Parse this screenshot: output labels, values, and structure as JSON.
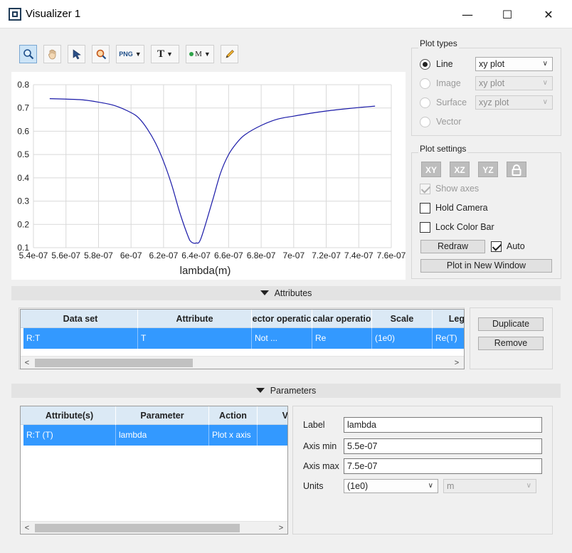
{
  "window": {
    "title": "Visualizer 1",
    "minimize": "—",
    "maximize": "☐",
    "close": "✕"
  },
  "toolbar": {
    "png_label": "PNG",
    "text_label": "T",
    "marker_label": "M"
  },
  "chart_data": {
    "type": "line",
    "xlabel": "lambda(m)",
    "ylabel": "",
    "xlim": [
      5.4e-07,
      7.6e-07
    ],
    "ylim": [
      0.1,
      0.8
    ],
    "x_ticks": [
      "5.4e-07",
      "5.6e-07",
      "5.8e-07",
      "6e-07",
      "6.2e-07",
      "6.4e-07",
      "6.6e-07",
      "6.8e-07",
      "7e-07",
      "7.2e-07",
      "7.4e-07",
      "7.6e-07"
    ],
    "y_ticks": [
      "0.1",
      "0.2",
      "0.3",
      "0.4",
      "0.5",
      "0.6",
      "0.7",
      "0.8"
    ],
    "grid": true,
    "series": [
      {
        "color": "#1a1aa8",
        "x": [
          5.5e-07,
          5.6e-07,
          5.7e-07,
          5.8e-07,
          5.9e-07,
          6e-07,
          6.05e-07,
          6.1e-07,
          6.15e-07,
          6.2e-07,
          6.25e-07,
          6.3e-07,
          6.35e-07,
          6.37e-07,
          6.4e-07,
          6.43e-07,
          6.5e-07,
          6.55e-07,
          6.6e-07,
          6.65e-07,
          6.7e-07,
          6.8e-07,
          6.9e-07,
          7e-07,
          7.1e-07,
          7.2e-07,
          7.3e-07,
          7.4e-07,
          7.5e-07
        ],
        "y": [
          0.74,
          0.738,
          0.735,
          0.725,
          0.71,
          0.68,
          0.655,
          0.61,
          0.55,
          0.47,
          0.37,
          0.25,
          0.15,
          0.125,
          0.12,
          0.14,
          0.3,
          0.42,
          0.5,
          0.55,
          0.585,
          0.625,
          0.652,
          0.665,
          0.677,
          0.687,
          0.695,
          0.702,
          0.708
        ]
      }
    ]
  },
  "plot_types": {
    "title": "Plot types",
    "line": {
      "label": "Line",
      "select": "xy plot"
    },
    "image": {
      "label": "Image",
      "select": "xy plot"
    },
    "surface": {
      "label": "Surface",
      "select": "xyz plot"
    },
    "vector": {
      "label": "Vector"
    }
  },
  "plot_settings": {
    "title": "Plot settings",
    "axis_buttons": [
      "XY",
      "XZ",
      "YZ"
    ],
    "show_axes": "Show axes",
    "hold_camera": "Hold Camera",
    "lock_color_bar": "Lock Color Bar",
    "redraw": "Redraw",
    "auto": "Auto",
    "plot_new_window": "Plot in New Window"
  },
  "attributes": {
    "section_label": "Attributes",
    "columns": [
      "Data set",
      "Attribute",
      "ector operatic",
      "calar operatio",
      "Scale",
      "Leg"
    ],
    "row": [
      "R:T",
      "T",
      "Not ...",
      "Re",
      "(1e0)",
      "Re(T)"
    ],
    "duplicate": "Duplicate",
    "remove": "Remove"
  },
  "parameters": {
    "section_label": "Parameters",
    "columns": [
      "Attribute(s)",
      "Parameter",
      "Action",
      "V"
    ],
    "row": [
      "R:T (T)",
      "lambda",
      "Plot x axis",
      ""
    ],
    "label_label": "Label",
    "label_value": "lambda",
    "axis_min_label": "Axis min",
    "axis_min_value": "5.5e-07",
    "axis_max_label": "Axis max",
    "axis_max_value": "7.5e-07",
    "units_label": "Units",
    "units_value": "(1e0)",
    "units_unit": "m"
  }
}
